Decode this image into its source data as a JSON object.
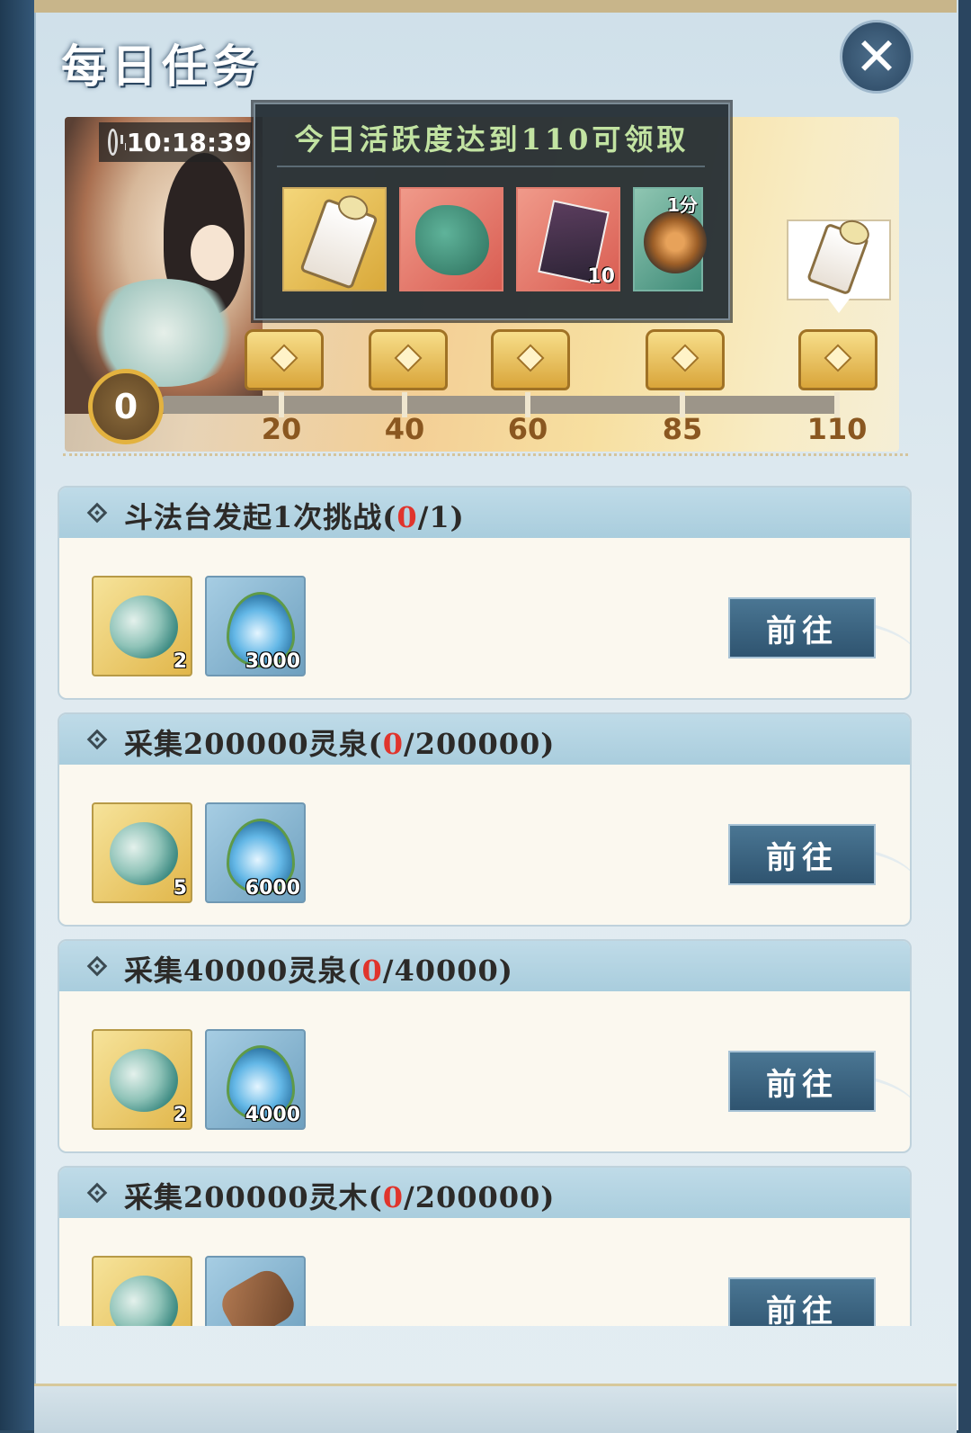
{
  "header": {
    "title": "每日任务",
    "close_label": "✕"
  },
  "banner": {
    "timer": "10:18:39"
  },
  "popup": {
    "title": "今日活跃度达到110可领取",
    "rewards": [
      {
        "name": "scroll-icon",
        "qty": ""
      },
      {
        "name": "jade-fragment-icon",
        "qty": ""
      },
      {
        "name": "book-icon",
        "qty": "10"
      },
      {
        "name": "coin-icon",
        "tag": "1分"
      }
    ]
  },
  "activity": {
    "score": "0",
    "milestones": [
      "20",
      "40",
      "60",
      "85",
      "110"
    ],
    "progress": 0
  },
  "tasks": [
    {
      "title_prefix": "斗法台发起1次挑战(",
      "current": "0",
      "title_suffix": "/1)",
      "reward1_qty": "2",
      "reward2_qty": "3000",
      "reward2_icon": "water-drop-icon",
      "button": "前往"
    },
    {
      "title_prefix": "采集200000灵泉(",
      "current": "0",
      "title_suffix": "/200000)",
      "reward1_qty": "5",
      "reward2_qty": "6000",
      "reward2_icon": "water-drop-icon",
      "button": "前往"
    },
    {
      "title_prefix": "采集40000灵泉(",
      "current": "0",
      "title_suffix": "/40000)",
      "reward1_qty": "2",
      "reward2_qty": "4000",
      "reward2_icon": "water-drop-icon",
      "button": "前往"
    },
    {
      "title_prefix": "采集200000灵木(",
      "current": "0",
      "title_suffix": "/200000)",
      "reward1_qty": "",
      "reward2_qty": "",
      "reward2_icon": "wood-log-icon",
      "button": "前往"
    }
  ],
  "colors": {
    "progress_red": "#e0342c",
    "popup_title": "#c2e3a2",
    "milestone": "#8a5720"
  }
}
